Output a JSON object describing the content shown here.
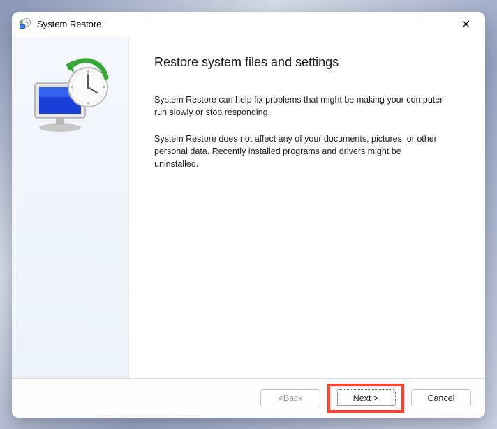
{
  "titlebar": {
    "title": "System Restore"
  },
  "content": {
    "heading": "Restore system files and settings",
    "paragraph1": "System Restore can help fix problems that might be making your computer run slowly or stop responding.",
    "paragraph2": "System Restore does not affect any of your documents, pictures, or other personal data. Recently installed programs and drivers might be uninstalled."
  },
  "footer": {
    "back_prefix": "< ",
    "back_underline": "B",
    "back_suffix": "ack",
    "next_underline": "N",
    "next_suffix": "ext >",
    "cancel": "Cancel"
  }
}
